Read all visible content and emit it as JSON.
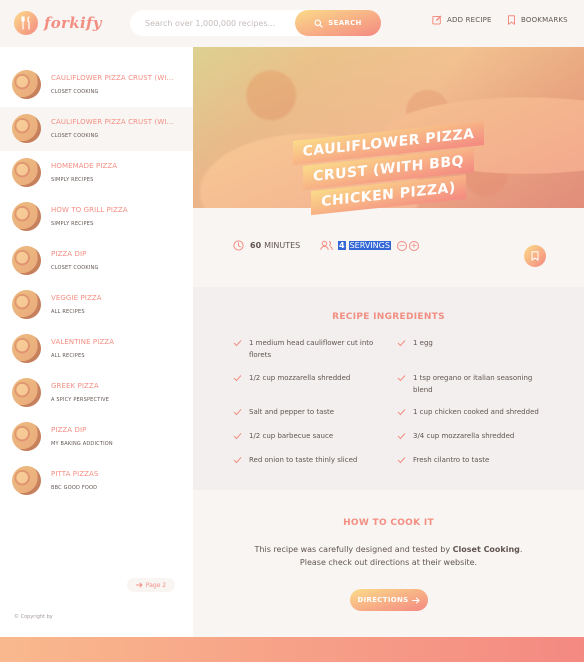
{
  "header": {
    "logo_text": "forkify",
    "search_placeholder": "Search over 1,000,000 recipes...",
    "search_button": "SEARCH",
    "add_recipe": "ADD RECIPE",
    "bookmarks": "BOOKMARKS"
  },
  "results": [
    {
      "title": "CAULIFLOWER PIZZA CRUST (WI...",
      "publisher": "CLOSET COOKING"
    },
    {
      "title": "CAULIFLOWER PIZZA CRUST (WI...",
      "publisher": "CLOSET COOKING"
    },
    {
      "title": "HOMEMADE PIZZA",
      "publisher": "SIMPLY RECIPES"
    },
    {
      "title": "HOW TO GRILL PIZZA",
      "publisher": "SIMPLY RECIPES"
    },
    {
      "title": "PIZZA DIP",
      "publisher": "CLOSET COOKING"
    },
    {
      "title": "VEGGIE PIZZA",
      "publisher": "ALL RECIPES"
    },
    {
      "title": "VALENTINE PIZZA",
      "publisher": "ALL RECIPES"
    },
    {
      "title": "GREEK PIZZA",
      "publisher": "A SPICY PERSPECTIVE"
    },
    {
      "title": "PIZZA DIP",
      "publisher": "MY BAKING ADDICTION"
    },
    {
      "title": "PITTA PIZZAS",
      "publisher": "BBC GOOD FOOD"
    }
  ],
  "pagination": {
    "next_label": "Page 2"
  },
  "copyright": "© Copyright by",
  "recipe": {
    "title_lines": [
      "CAULIFLOWER PIZZA",
      "CRUST (WITH BBQ",
      "CHICKEN PIZZA)"
    ],
    "cooking_time": "60",
    "minutes_label": "MINUTES",
    "servings": "4",
    "servings_label": "SERVINGS",
    "ingredients_heading": "RECIPE INGREDIENTS",
    "ingredients": [
      "1 medium head cauliflower cut into florets",
      "1 egg",
      "1/2 cup mozzarella shredded",
      "1 tsp oregano or italian seasoning blend",
      "Salt and pepper to taste",
      "1 cup chicken cooked and shredded",
      "1/2 cup barbecue sauce",
      "3/4 cup mozzarella shredded",
      "Red onion to taste thinly sliced",
      "Fresh cilantro to taste"
    ],
    "cook_heading": "HOW TO COOK IT",
    "cook_text_pre": "This recipe was carefully designed and tested by ",
    "cook_publisher": "Closet Cooking",
    "cook_text_post": ". Please check out directions at their website.",
    "directions_button": "DIRECTIONS"
  },
  "colors": {
    "accent_start": "#fbdb89",
    "accent_end": "#f48982",
    "primary": "#f38e82"
  }
}
